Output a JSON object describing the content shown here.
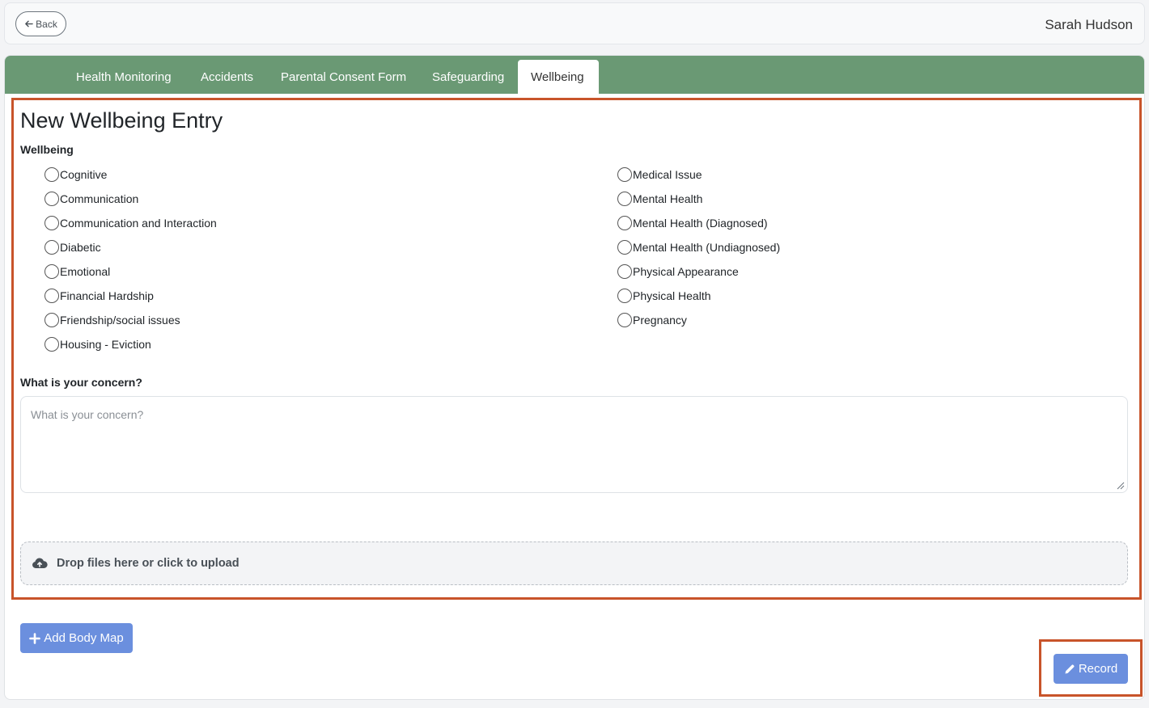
{
  "header": {
    "back_label": "Back",
    "user_name": "Sarah Hudson"
  },
  "tabs": [
    {
      "label": "Health Monitoring",
      "active": false
    },
    {
      "label": "Accidents",
      "active": false
    },
    {
      "label": "Parental Consent Form",
      "active": false
    },
    {
      "label": "Safeguarding",
      "active": false
    },
    {
      "label": "Wellbeing",
      "active": true
    }
  ],
  "form": {
    "title": "New Wellbeing Entry",
    "wellbeing_label": "Wellbeing",
    "left_options": [
      {
        "label": "Cognitive",
        "checked": false
      },
      {
        "label": "Communication",
        "checked": false
      },
      {
        "label": "Communication and Interaction",
        "checked": false
      },
      {
        "label": "Diabetic",
        "checked": false
      },
      {
        "label": "Emotional",
        "checked": false
      },
      {
        "label": "Financial Hardship",
        "checked": false
      },
      {
        "label": "Friendship/social issues",
        "checked": false
      },
      {
        "label": "Housing - Eviction",
        "checked": false
      }
    ],
    "right_options": [
      {
        "label": "Medical Issue",
        "checked": false
      },
      {
        "label": "Mental Health",
        "checked": false
      },
      {
        "label": "Mental Health (Diagnosed)",
        "checked": false
      },
      {
        "label": "Mental Health (Undiagnosed)",
        "checked": false
      },
      {
        "label": "Physical Appearance",
        "checked": false
      },
      {
        "label": "Physical Health",
        "checked": false
      },
      {
        "label": "Pregnancy",
        "checked": false
      }
    ],
    "concern_label": "What is your concern?",
    "concern_placeholder": "What is your concern?",
    "concern_value": "",
    "dropzone_label": "Drop files here or click to upload"
  },
  "actions": {
    "add_body_map_label": "Add Body Map",
    "record_label": "Record"
  },
  "colors": {
    "tabbar": "#6a9974",
    "primary_button": "#6b8fde",
    "highlight": "#c8542a"
  }
}
